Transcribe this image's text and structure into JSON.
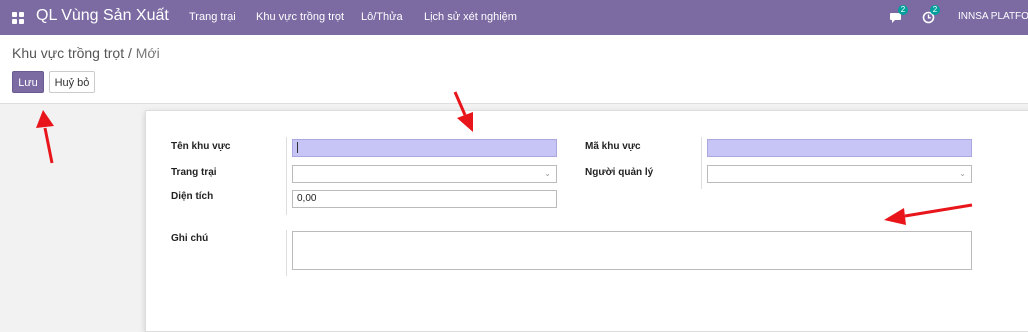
{
  "navbar": {
    "app_title": "QL Vùng Sản Xuất",
    "menu": [
      "Trang trại",
      "Khu vực trồng trọt",
      "Lô/Thửa",
      "Lịch sử xét nghiệm"
    ],
    "messages_badge": "2",
    "activities_badge": "2",
    "company": "INNSA PLATFO",
    "icons": [
      "apps-icon",
      "chat-icon",
      "activity-clock-icon"
    ],
    "color": "#7c6aa3"
  },
  "breadcrumb": {
    "parent": "Khu vực trồng trọt",
    "separator": "/",
    "current": "Mới"
  },
  "buttons": {
    "save": "Lưu",
    "discard": "Huỷ bỏ"
  },
  "form": {
    "ten_khu_vuc": {
      "label": "Tên khu vực",
      "value": ""
    },
    "trang_trai": {
      "label": "Trang trại",
      "value": ""
    },
    "dien_tich": {
      "label": "Diện tích",
      "value": "0,00"
    },
    "ghi_chu": {
      "label": "Ghi chú",
      "value": ""
    },
    "ma_khu_vuc": {
      "label": "Mã khu vực",
      "value": ""
    },
    "nguoi_quan_ly": {
      "label": "Người quản lý",
      "value": ""
    }
  },
  "colors": {
    "required_field": "#c7c5f5",
    "annotation_arrow": "#e8161b"
  }
}
